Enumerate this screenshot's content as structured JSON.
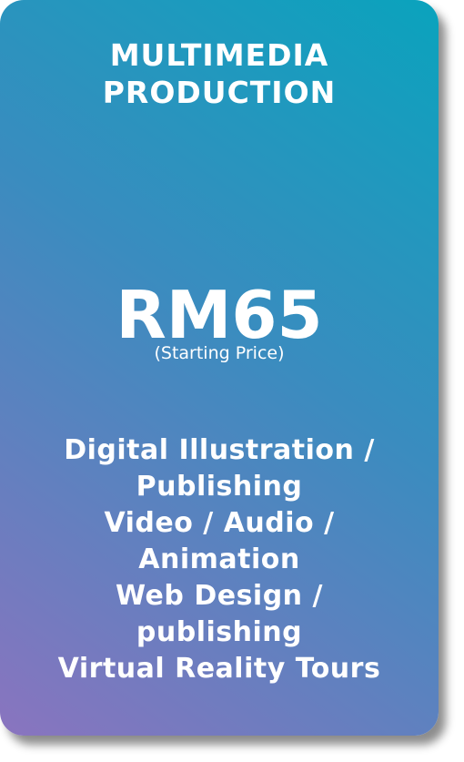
{
  "card": {
    "title_lines": [
      "MULTIMEDIA",
      "PRODUCTION"
    ],
    "price": "RM65",
    "price_note": "(Starting Price)",
    "services": [
      "Digital Illustration /",
      "Publishing",
      "Video / Audio /",
      "Animation",
      "Web Design /",
      "publishing",
      "Virtual Reality Tours"
    ],
    "colors": {
      "gradient_top_right": "#0aa3bd",
      "gradient_bottom_left": "#8a74bf",
      "text": "#ffffff"
    }
  }
}
